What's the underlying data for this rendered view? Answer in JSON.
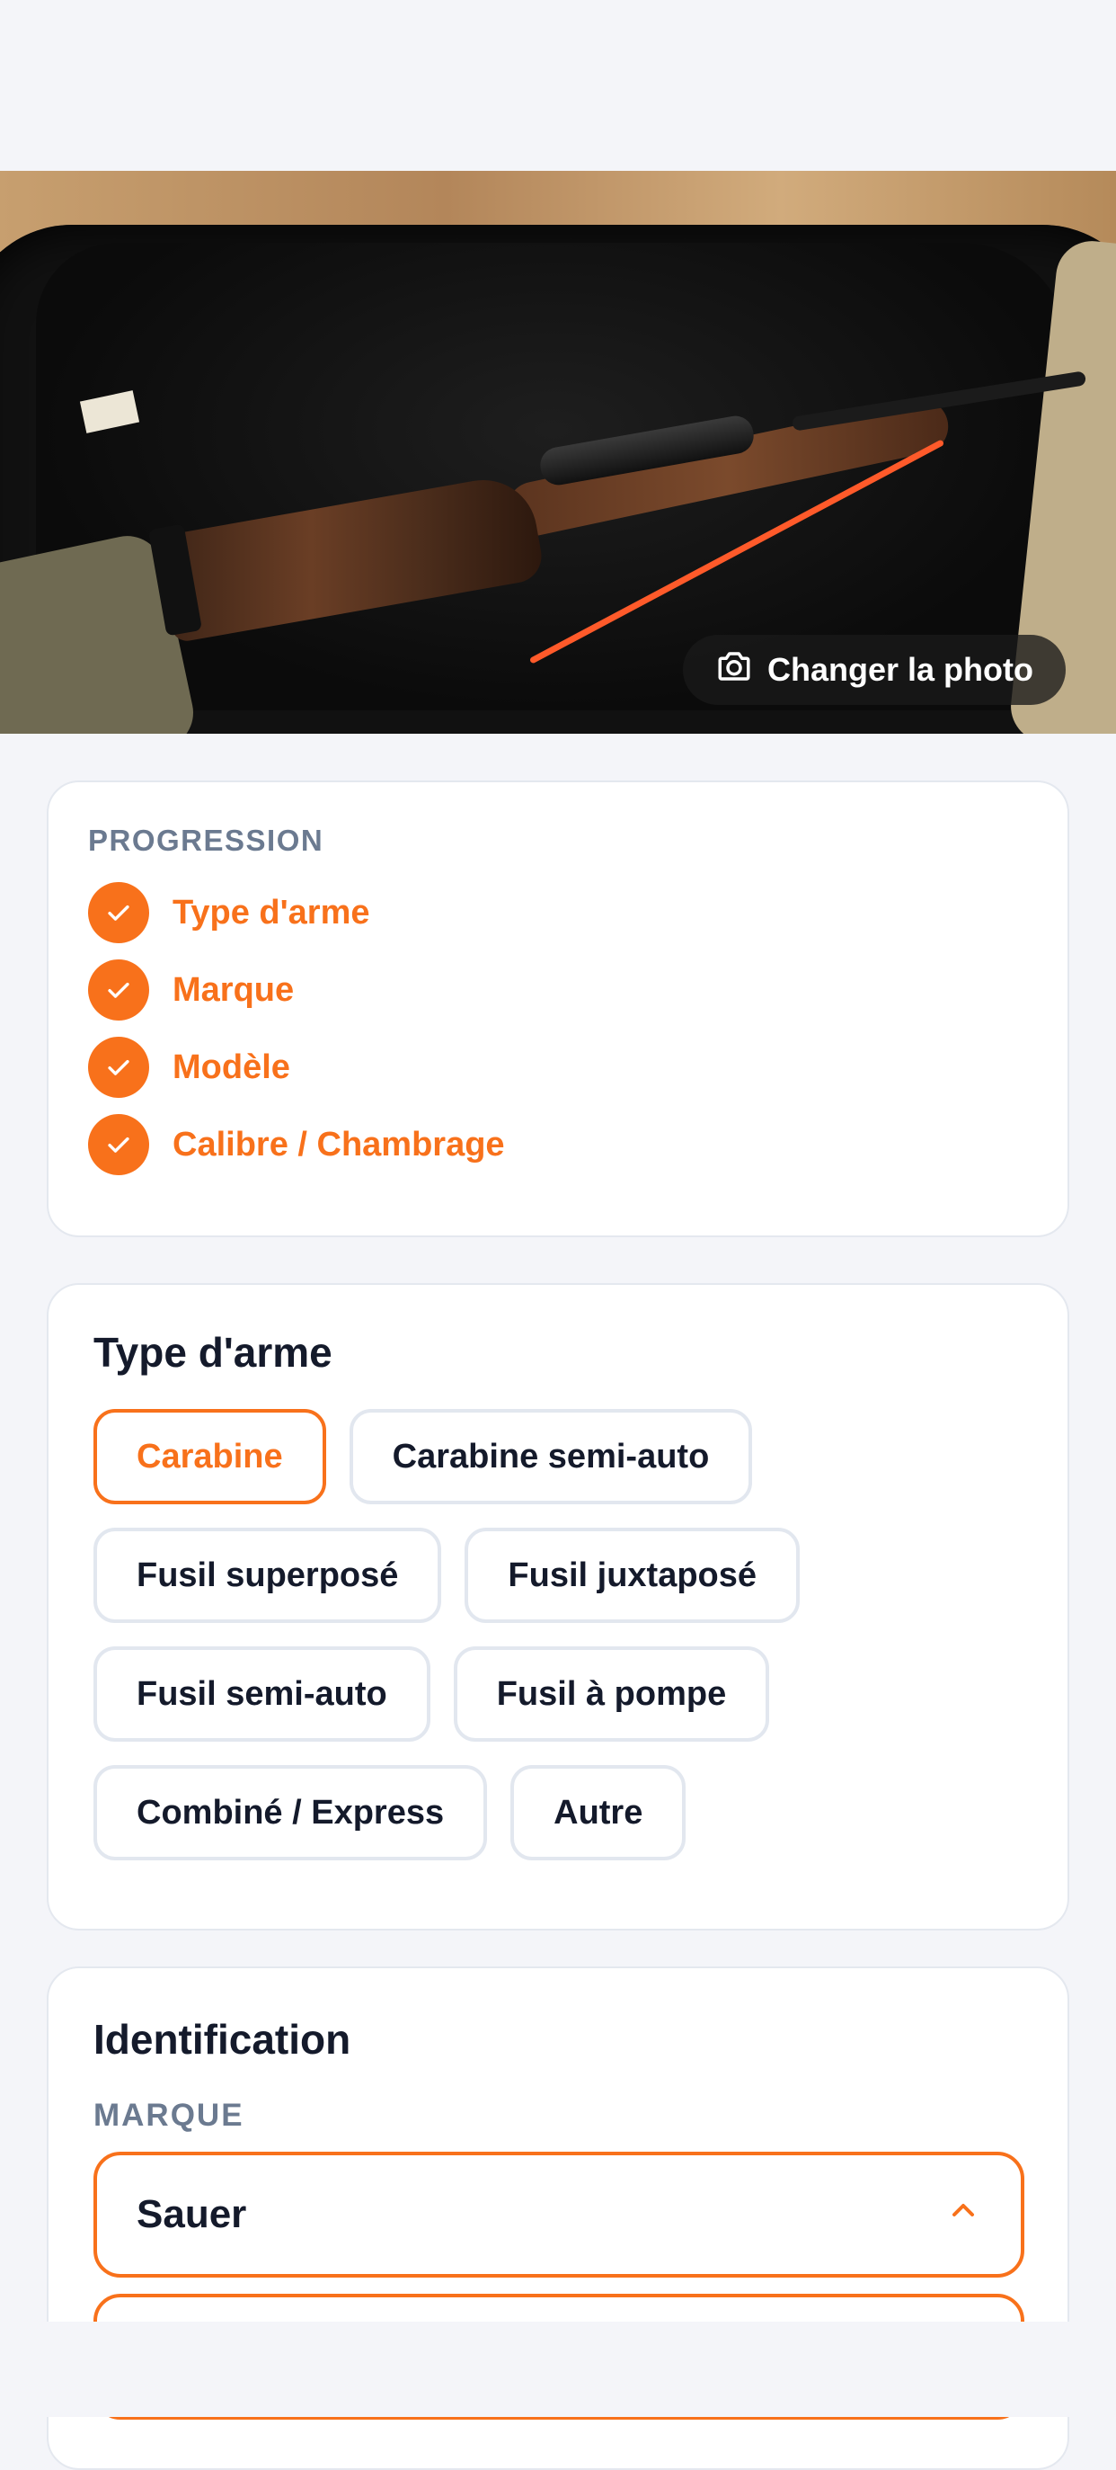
{
  "photo": {
    "change_label": "Changer la photo",
    "icon": "camera-icon"
  },
  "progress": {
    "title": "PROGRESSION",
    "steps": [
      {
        "label": "Type d'arme",
        "done": true
      },
      {
        "label": "Marque",
        "done": true
      },
      {
        "label": "Modèle",
        "done": true
      },
      {
        "label": "Calibre / Chambrage",
        "done": true
      }
    ]
  },
  "weapon_type": {
    "title": "Type d'arme",
    "options": [
      "Carabine",
      "Carabine semi-auto",
      "Fusil superposé",
      "Fusil juxtaposé",
      "Fusil semi-auto",
      "Fusil à pompe",
      "Combiné / Express",
      "Autre"
    ],
    "selected": "Carabine"
  },
  "identification": {
    "title": "Identification",
    "brand_label": "MARQUE",
    "brand_value": "Sauer"
  },
  "colors": {
    "accent": "#f8711b",
    "text": "#141a2b",
    "muted": "#6b7a90",
    "background": "#f4f5f9"
  }
}
